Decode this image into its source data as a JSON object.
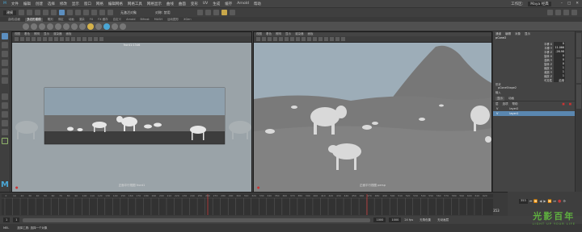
{
  "menubar": {
    "items": [
      "文件",
      "编辑",
      "创建",
      "选择",
      "修改",
      "显示",
      "窗口",
      "网格",
      "编辑网格",
      "网格工具",
      "网格显示",
      "曲线",
      "曲面",
      "变形",
      "UV",
      "生成",
      "缓存",
      "Arnold",
      "帮助"
    ],
    "workspace_label": "工作区:",
    "workspace_value": "Maya 经典"
  },
  "toolbar": {
    "mode_select": "建模",
    "search_placeholder": "",
    "no_live_surface": "无激活对象",
    "symmetry": "对称: 禁用"
  },
  "shelf_tabs": [
    "曲线/曲面",
    "多边形建模",
    "雕刻",
    "绑定",
    "动画",
    "渲染",
    "FX",
    "FX 缓存",
    "自定义",
    "Arnold",
    "Bifrost",
    "MASH",
    "运动图形",
    "XGen"
  ],
  "shelf_active_tab": "多边形建模",
  "viewport_left": {
    "menu": [
      "视图",
      "着色",
      "照明",
      "显示",
      "渲染器",
      "面板"
    ],
    "camera_top_label": "front1:1346",
    "camera_bottom_label": "正面平行视图 front1",
    "sky_color": "#8ea0ad",
    "ground_color": "#3f3f3f"
  },
  "viewport_right": {
    "menu": [
      "视图",
      "着色",
      "照明",
      "显示",
      "渲染器",
      "面板"
    ],
    "camera_bottom_label": "正面平行视图 persp",
    "sky_color": "#9dadb8",
    "ground_color": "#7a7a7a"
  },
  "channel_box": {
    "tabs": [
      "通道",
      "编辑",
      "对象",
      "显示"
    ],
    "object_name": "pCone2",
    "attributes": [
      {
        "name": "平移 X",
        "value": "0"
      },
      {
        "name": "平移 Y",
        "value": "11.066"
      },
      {
        "name": "平移 Z",
        "value": "-26.98"
      },
      {
        "name": "旋转 X",
        "value": "0"
      },
      {
        "name": "旋转 Y",
        "value": "0"
      },
      {
        "name": "旋转 Z",
        "value": "0"
      },
      {
        "name": "缩放 X",
        "value": "1"
      },
      {
        "name": "缩放 Y",
        "value": "1"
      },
      {
        "name": "缩放 Z",
        "value": "1"
      },
      {
        "name": "可见性",
        "value": "启用"
      }
    ],
    "shapes_label": "形状",
    "shape_name": "pConeShape2",
    "inputs_label": "输入"
  },
  "layer_editor": {
    "tabs": [
      "显示",
      "动画"
    ],
    "menu": [
      "层",
      "选项",
      "帮助"
    ],
    "layers": [
      {
        "vis": "V",
        "name": "layer2",
        "selected": false
      },
      {
        "vis": "V",
        "name": "layer1",
        "selected": true
      }
    ]
  },
  "timeline": {
    "ticks": [
      "0",
      "10",
      "20",
      "30",
      "40",
      "50",
      "60",
      "70",
      "80",
      "90",
      "100",
      "110",
      "120",
      "130",
      "140",
      "150",
      "160",
      "170",
      "180",
      "190",
      "200",
      "210",
      "220",
      "230",
      "240",
      "250",
      "260",
      "270",
      "280",
      "290",
      "300",
      "310",
      "320",
      "330",
      "340",
      "350",
      "360",
      "370",
      "380",
      "390",
      "400",
      "410",
      "420",
      "430",
      "440",
      "450",
      "460",
      "470",
      "480",
      "490",
      "500",
      "510",
      "520",
      "530",
      "540",
      "550",
      "560",
      "570",
      "580",
      "590",
      "600",
      "610",
      "620"
    ],
    "current_frame": "353",
    "range_start": "1",
    "range_inner_start": "1",
    "range_inner_end": "1000",
    "range_end": "1000",
    "fps": "24 fps",
    "char_set": "无角色集",
    "anim_layer": "无动画层"
  },
  "cmdline": {
    "lang": "MEL",
    "message": "选择工具: 选择一个对象"
  },
  "watermark": {
    "title": "光影百年",
    "subtitle": "LIGHT UP YOUR LIFE",
    "color": "#5fb13f"
  },
  "colors": {
    "accent": "#5c8fc0",
    "cone_blue": "#5b86a6",
    "keyframe_red": "#c43a3a"
  }
}
